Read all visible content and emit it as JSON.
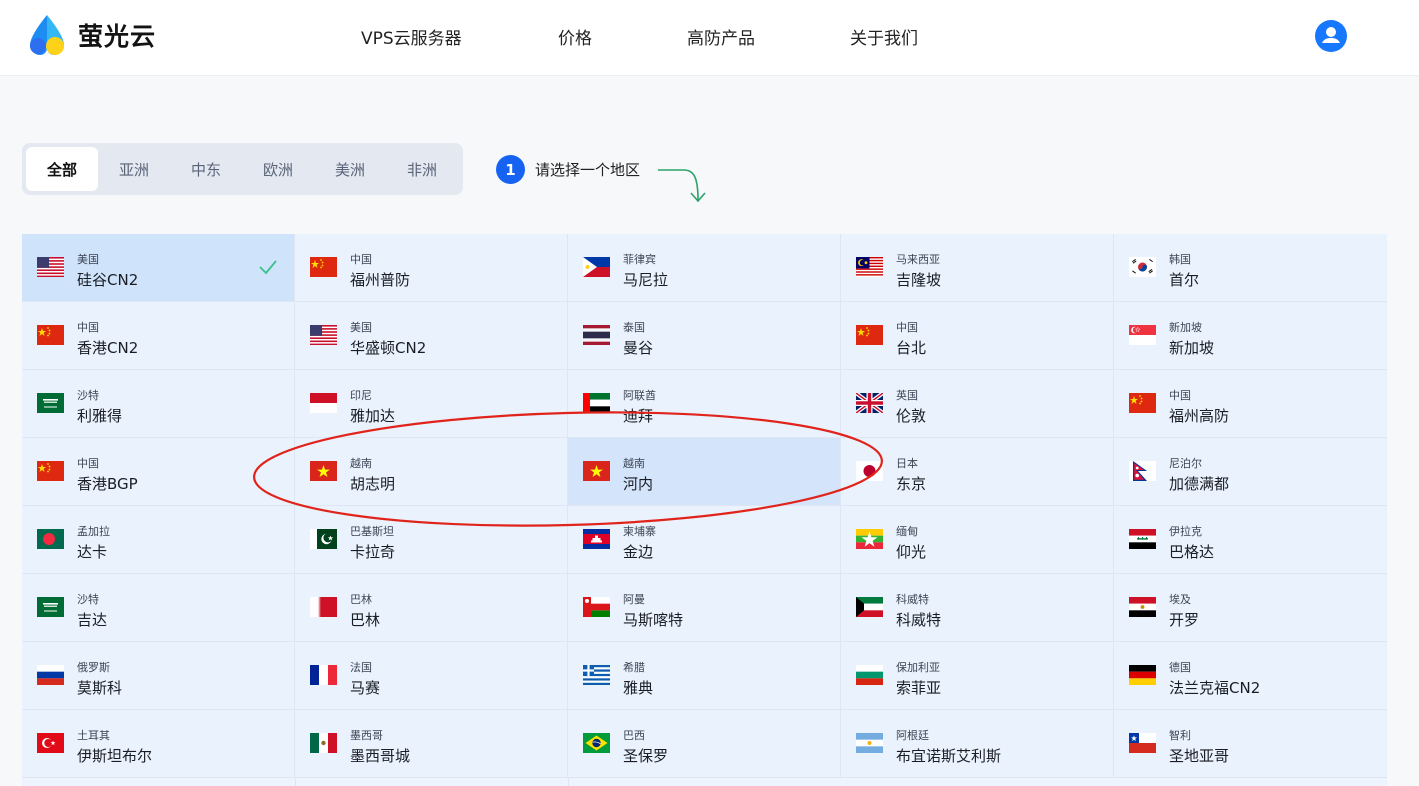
{
  "brand": {
    "name": "萤光云"
  },
  "nav": {
    "items": [
      "VPS云服务器",
      "价格",
      "高防产品",
      "关于我们"
    ]
  },
  "tabs": {
    "items": [
      "全部",
      "亚洲",
      "中东",
      "欧洲",
      "美洲",
      "非洲"
    ],
    "active": "全部"
  },
  "hint": {
    "step": "1",
    "text": "请选择一个地区"
  },
  "regions": [
    {
      "country": "美国",
      "city": "硅谷CN2",
      "flag": "us-flag-icon",
      "selected": true
    },
    {
      "country": "中国",
      "city": "福州普防",
      "flag": "cn-flag-icon"
    },
    {
      "country": "菲律宾",
      "city": "马尼拉",
      "flag": "ph-flag-icon"
    },
    {
      "country": "马来西亚",
      "city": "吉隆坡",
      "flag": "my-flag-icon"
    },
    {
      "country": "韩国",
      "city": "首尔",
      "flag": "kr-flag-icon"
    },
    {
      "country": "中国",
      "city": "香港CN2",
      "flag": "cn-flag-icon"
    },
    {
      "country": "美国",
      "city": "华盛顿CN2",
      "flag": "us-flag-icon"
    },
    {
      "country": "泰国",
      "city": "曼谷",
      "flag": "th-flag-icon"
    },
    {
      "country": "中国",
      "city": "台北",
      "flag": "cn-flag-icon"
    },
    {
      "country": "新加坡",
      "city": "新加坡",
      "flag": "sg-flag-icon"
    },
    {
      "country": "沙特",
      "city": "利雅得",
      "flag": "sa-flag-icon"
    },
    {
      "country": "印尼",
      "city": "雅加达",
      "flag": "id-flag-icon"
    },
    {
      "country": "阿联酋",
      "city": "迪拜",
      "flag": "ae-flag-icon"
    },
    {
      "country": "英国",
      "city": "伦敦",
      "flag": "gb-flag-icon"
    },
    {
      "country": "中国",
      "city": "福州高防",
      "flag": "cn-flag-icon"
    },
    {
      "country": "中国",
      "city": "香港BGP",
      "flag": "cn-flag-icon"
    },
    {
      "country": "越南",
      "city": "胡志明",
      "flag": "vn-flag-icon"
    },
    {
      "country": "越南",
      "city": "河内",
      "flag": "vn-flag-icon",
      "hover": true
    },
    {
      "country": "日本",
      "city": "东京",
      "flag": "jp-flag-icon"
    },
    {
      "country": "尼泊尔",
      "city": "加德满都",
      "flag": "np-flag-icon"
    },
    {
      "country": "孟加拉",
      "city": "达卡",
      "flag": "bd-flag-icon"
    },
    {
      "country": "巴基斯坦",
      "city": "卡拉奇",
      "flag": "pk-flag-icon"
    },
    {
      "country": "柬埔寨",
      "city": "金边",
      "flag": "kh-flag-icon"
    },
    {
      "country": "缅甸",
      "city": "仰光",
      "flag": "mm-flag-icon"
    },
    {
      "country": "伊拉克",
      "city": "巴格达",
      "flag": "iq-flag-icon"
    },
    {
      "country": "沙特",
      "city": "吉达",
      "flag": "sa-flag-icon"
    },
    {
      "country": "巴林",
      "city": "巴林",
      "flag": "bh-flag-icon"
    },
    {
      "country": "阿曼",
      "city": "马斯喀特",
      "flag": "om-flag-icon"
    },
    {
      "country": "科威特",
      "city": "科威特",
      "flag": "kw-flag-icon"
    },
    {
      "country": "埃及",
      "city": "开罗",
      "flag": "eg-flag-icon"
    },
    {
      "country": "俄罗斯",
      "city": "莫斯科",
      "flag": "ru-flag-icon"
    },
    {
      "country": "法国",
      "city": "马赛",
      "flag": "fr-flag-icon"
    },
    {
      "country": "希腊",
      "city": "雅典",
      "flag": "gr-flag-icon"
    },
    {
      "country": "保加利亚",
      "city": "索菲亚",
      "flag": "bg-flag-icon"
    },
    {
      "country": "德国",
      "city": "法兰克福CN2",
      "flag": "de-flag-icon"
    },
    {
      "country": "土耳其",
      "city": "伊斯坦布尔",
      "flag": "tr-flag-icon"
    },
    {
      "country": "墨西哥",
      "city": "墨西哥城",
      "flag": "mx-flag-icon"
    },
    {
      "country": "巴西",
      "city": "圣保罗",
      "flag": "br-flag-icon"
    },
    {
      "country": "阿根廷",
      "city": "布宜诺斯艾利斯",
      "flag": "ar-flag-icon"
    },
    {
      "country": "智利",
      "city": "圣地亚哥",
      "flag": "cl-flag-icon"
    }
  ],
  "colors": {
    "accent": "#1663f2",
    "selected_bg": "#cfe3fb",
    "check": "#3cc08c",
    "annotation": "#e0241b"
  }
}
